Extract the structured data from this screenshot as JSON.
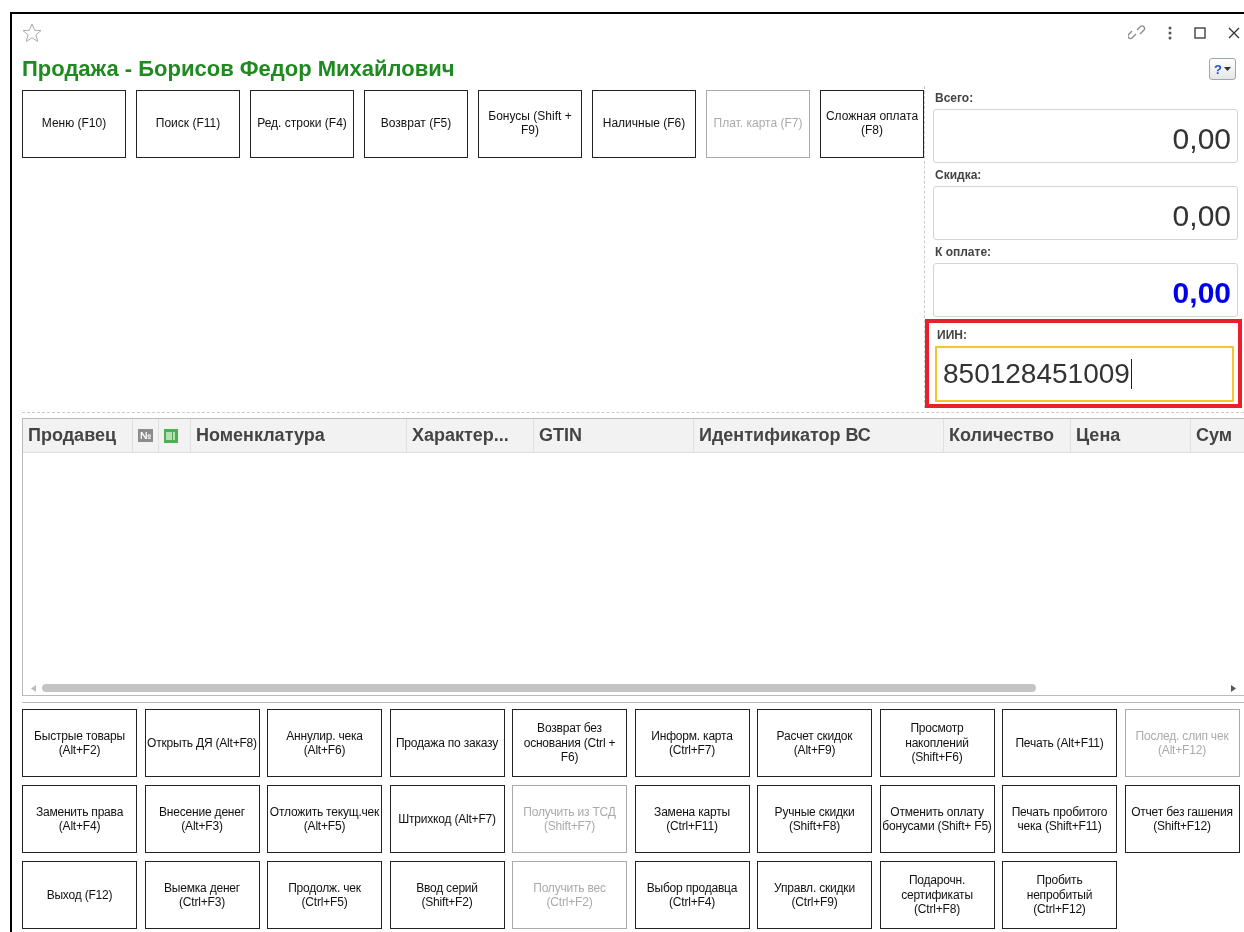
{
  "window": {
    "title": "Продажа - Борисов Федор Михайлович",
    "help_button": "?"
  },
  "top_buttons": [
    {
      "label": "Меню (F10)",
      "disabled": false
    },
    {
      "label": "Поиск (F11)",
      "disabled": false
    },
    {
      "label": "Ред. строки (F4)",
      "disabled": false
    },
    {
      "label": "Возврат (F5)",
      "disabled": false
    },
    {
      "label": "Бонусы (Shift + F9)",
      "disabled": false
    },
    {
      "label": "Наличные (F6)",
      "disabled": false
    },
    {
      "label": "Плат. карта (F7)",
      "disabled": true
    },
    {
      "label": "Сложная оплата (F8)",
      "disabled": false
    }
  ],
  "totals": [
    {
      "label": "Всего:",
      "value": "0,00",
      "kind": "plain"
    },
    {
      "label": "Скидка:",
      "value": "0,00",
      "kind": "plain"
    },
    {
      "label": "К оплате:",
      "value": "0,00",
      "kind": "accent"
    }
  ],
  "iin": {
    "label": "ИИН:",
    "value": "850128451009",
    "focused": true,
    "highlighted": true
  },
  "table": {
    "columns": [
      {
        "label": "Продавец",
        "kind": "text"
      },
      {
        "label": "№",
        "kind": "badge"
      },
      {
        "kind": "icon"
      },
      {
        "label": "Номенклатура",
        "kind": "text"
      },
      {
        "label": "Характер...",
        "kind": "text"
      },
      {
        "label": "GTIN",
        "kind": "text"
      },
      {
        "label": "Идентификатор ВС",
        "kind": "text"
      },
      {
        "label": "Количество",
        "kind": "text"
      },
      {
        "label": "Цена",
        "kind": "text"
      },
      {
        "label": "Сум",
        "kind": "text"
      }
    ]
  },
  "bottom_buttons": [
    [
      {
        "label": "Быстрые товары (Alt+F2)",
        "disabled": false
      },
      {
        "label": "Открыть ДЯ (Alt+F8)",
        "disabled": false
      },
      {
        "label": "Аннулир. чека (Alt+F6)",
        "disabled": false
      },
      {
        "label": "Продажа по заказу",
        "disabled": false
      },
      {
        "label": "Возврат без основания (Ctrl + F6)",
        "disabled": false
      },
      {
        "label": "Информ. карта (Ctrl+F7)",
        "disabled": false
      },
      {
        "label": "Расчет скидок (Alt+F9)",
        "disabled": false
      },
      {
        "label": "Просмотр накоплений (Shift+F6)",
        "disabled": false
      },
      {
        "label": "Печать (Alt+F11)",
        "disabled": false
      },
      {
        "label": "Послед. слип чек (Alt+F12)",
        "disabled": true
      }
    ],
    [
      {
        "label": "Заменить права (Alt+F4)",
        "disabled": false
      },
      {
        "label": "Внесение денег (Alt+F3)",
        "disabled": false
      },
      {
        "label": "Отложить текущ.чек (Alt+F5)",
        "disabled": false
      },
      {
        "label": "Штрихкод (Alt+F7)",
        "disabled": false
      },
      {
        "label": "Получить из ТСД (Shift+F7)",
        "disabled": true
      },
      {
        "label": "Замена карты (Ctrl+F11)",
        "disabled": false
      },
      {
        "label": "Ручные скидки (Shift+F8)",
        "disabled": false
      },
      {
        "label": "Отменить оплату бонусами (Shift+ F5)",
        "disabled": false
      },
      {
        "label": "Печать пробитого чека (Shift+F11)",
        "disabled": false
      },
      {
        "label": "Отчет без гашения (Shift+F12)",
        "disabled": false
      }
    ],
    [
      {
        "label": "Выход (F12)",
        "disabled": false
      },
      {
        "label": "Выемка денег (Ctrl+F3)",
        "disabled": false
      },
      {
        "label": "Продолж. чек (Ctrl+F5)",
        "disabled": false
      },
      {
        "label": "Ввод серий (Shift+F2)",
        "disabled": false
      },
      {
        "label": "Получить вес (Ctrl+F2)",
        "disabled": true
      },
      {
        "label": "Выбор продавца (Ctrl+F4)",
        "disabled": false
      },
      {
        "label": "Управл. скидки (Ctrl+F9)",
        "disabled": false
      },
      {
        "label": "Подарочн. сертификаты (Ctrl+F8)",
        "disabled": false
      },
      {
        "label": "Пробить непробитый (Ctrl+F12)",
        "disabled": false
      }
    ]
  ]
}
